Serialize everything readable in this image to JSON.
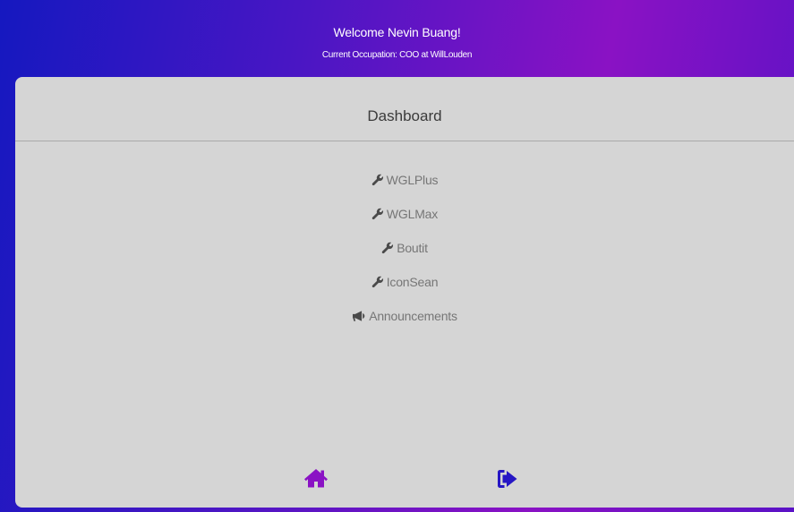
{
  "header": {
    "welcome": "Welcome Nevin Buang!",
    "occupation": "Current Occupation: COO at WillLouden"
  },
  "panel": {
    "title": "Dashboard",
    "menu": [
      {
        "label": "WGLPlus",
        "icon": "wrench-icon"
      },
      {
        "label": "WGLMax",
        "icon": "wrench-icon"
      },
      {
        "label": "Boutit",
        "icon": "wrench-icon"
      },
      {
        "label": "IconSean",
        "icon": "wrench-icon"
      },
      {
        "label": "Announcements",
        "icon": "megaphone-icon"
      }
    ]
  },
  "footer": {
    "home_icon": "home-icon",
    "logout_icon": "sign-out-icon"
  },
  "colors": {
    "home": "#8a12c4",
    "logout": "#2616c4",
    "panel_bg": "#d5d5d5",
    "menu_text": "#767676"
  }
}
